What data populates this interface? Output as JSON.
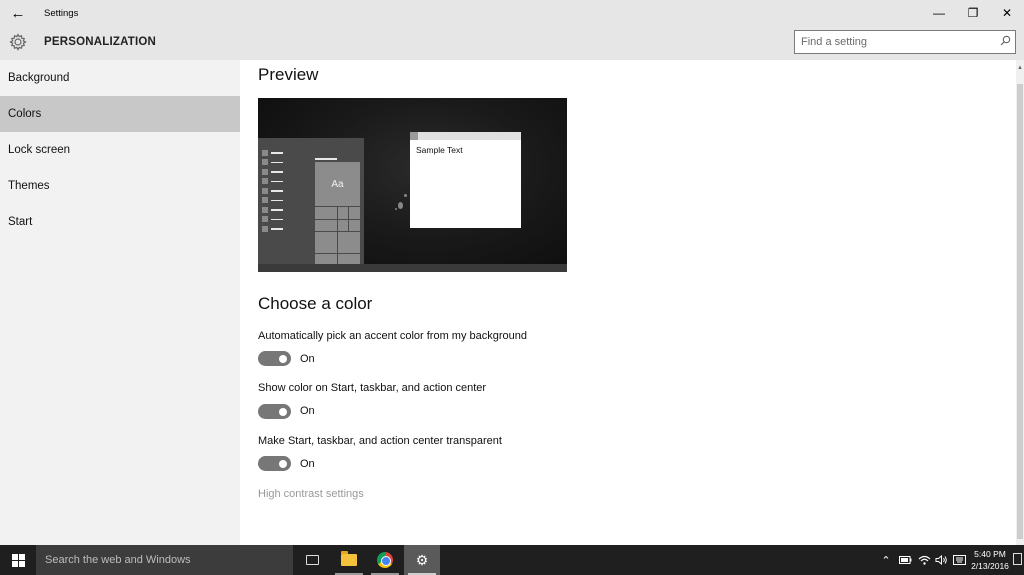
{
  "window": {
    "title": "Settings",
    "back_icon": "back-arrow-icon",
    "controls": {
      "minimize": "—",
      "restore": "❐",
      "close": "✕"
    }
  },
  "header": {
    "title": "PERSONALIZATION",
    "icon": "gear-icon",
    "search_placeholder": "Find a setting",
    "search_value": ""
  },
  "sidebar": {
    "items": [
      {
        "label": "Background",
        "active": false
      },
      {
        "label": "Colors",
        "active": true
      },
      {
        "label": "Lock screen",
        "active": false
      },
      {
        "label": "Themes",
        "active": false
      },
      {
        "label": "Start",
        "active": false
      }
    ]
  },
  "main": {
    "preview_heading": "Preview",
    "preview": {
      "tile_label": "Aa",
      "window_text": "Sample Text"
    },
    "choose_heading": "Choose a color",
    "settings": [
      {
        "label": "Automatically pick an accent color from my background",
        "state": "On",
        "on": true
      },
      {
        "label": "Show color on Start, taskbar, and action center",
        "state": "On",
        "on": true
      },
      {
        "label": "Make Start, taskbar, and action center transparent",
        "state": "On",
        "on": true
      }
    ],
    "link": "High contrast settings"
  },
  "taskbar": {
    "search_placeholder": "Search the web and Windows",
    "clock": {
      "time": "5:40 PM",
      "date": "2/13/2016"
    },
    "colors": {
      "bg": "#1f1f1f",
      "search_bg": "#3c3c3c"
    }
  }
}
